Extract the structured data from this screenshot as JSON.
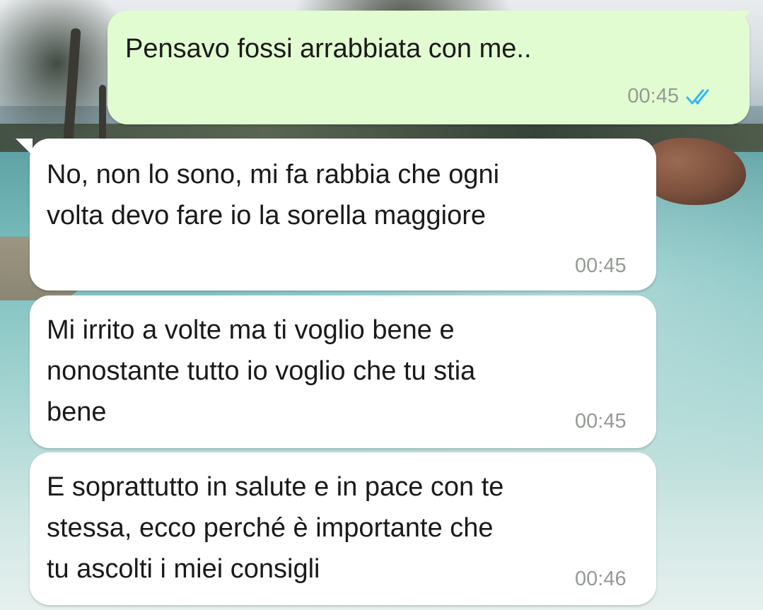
{
  "messages": [
    {
      "direction": "outgoing",
      "text": "Pensavo fossi arrabbiata con me..",
      "time": "00:45",
      "status": "read",
      "status_icon": "double-check-icon"
    },
    {
      "direction": "incoming",
      "text": "No, non lo sono, mi fa rabbia che ogni\nvolta devo fare io la sorella maggiore",
      "time": "00:45"
    },
    {
      "direction": "incoming",
      "text": "Mi irrito a volte ma ti voglio bene e\nnonostante tutto io voglio che tu stia\nbene",
      "time": "00:45"
    },
    {
      "direction": "incoming",
      "text": "E soprattutto in salute e in pace con te\nstessa, ecco perché è importante che\ntu ascolti i miei consigli",
      "time": "00:46"
    }
  ],
  "colors": {
    "outgoing_bubble": "#e2fcd2",
    "incoming_bubble": "#ffffff",
    "read_tick": "#34b7f1",
    "meta_text": "#959a95"
  }
}
